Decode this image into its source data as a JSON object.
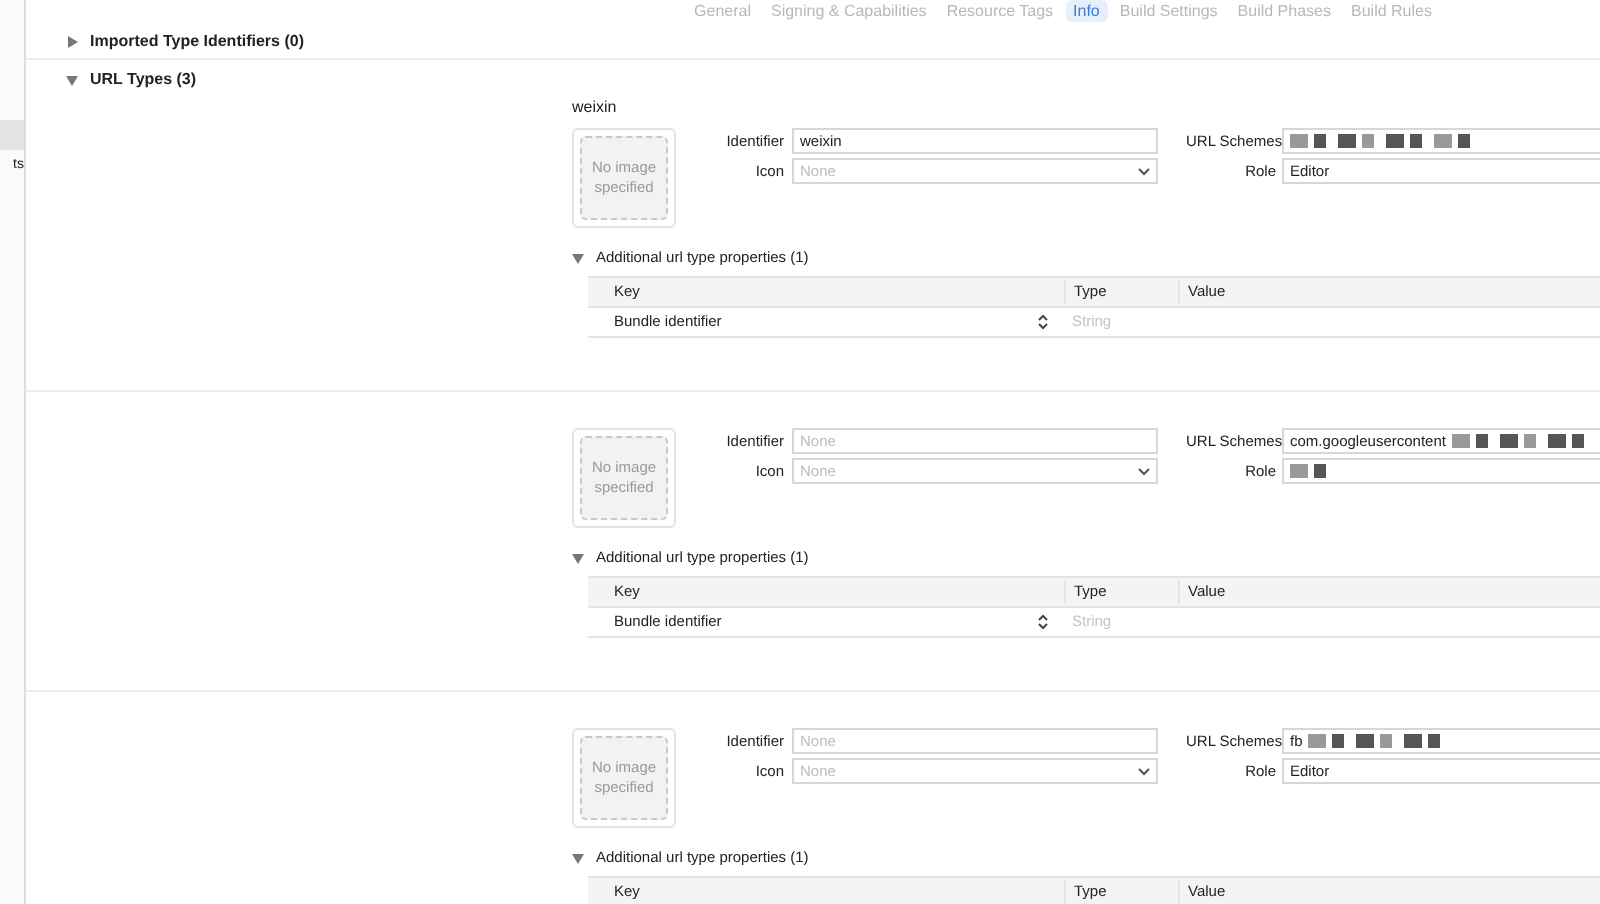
{
  "tabs": [
    {
      "label": "General",
      "selected": false
    },
    {
      "label": "Signing & Capabilities",
      "selected": false
    },
    {
      "label": "Resource Tags",
      "selected": false
    },
    {
      "label": "Info",
      "selected": true
    },
    {
      "label": "Build Settings",
      "selected": false
    },
    {
      "label": "Build Phases",
      "selected": false
    },
    {
      "label": "Build Rules",
      "selected": false
    }
  ],
  "sidebar": {
    "items": [
      {
        "label": "ts",
        "selected": false
      }
    ]
  },
  "sections": [
    {
      "title": "Imported Type Identifiers (0)",
      "expanded": false
    },
    {
      "title": "URL Types (3)",
      "expanded": true
    }
  ],
  "url_types": [
    {
      "name": "weixin",
      "image_text": "No image specified",
      "identifier_label": "Identifier",
      "identifier": "weixin",
      "icon_label": "Icon",
      "icon_placeholder": "None",
      "schemes_label": "URL Schemes",
      "scheme_redacted": true,
      "role_label": "Role",
      "role": "Editor",
      "role_redacted": false,
      "additional": {
        "title": "Additional url type properties (1)",
        "expanded": true,
        "columns": [
          "Key",
          "Type",
          "Value"
        ],
        "rows": [
          {
            "key": "Bundle identifier",
            "type_placeholder": "String"
          }
        ]
      }
    },
    {
      "image_text": "No image specified",
      "identifier_label": "Identifier",
      "identifier_placeholder": "None",
      "icon_label": "Icon",
      "icon_placeholder": "None",
      "schemes_label": "URL Schemes",
      "scheme": "com.googleusercontent",
      "scheme_redacted": true,
      "role_label": "Role",
      "role_redacted": true,
      "additional": {
        "title": "Additional url type properties (1)",
        "expanded": true,
        "columns": [
          "Key",
          "Type",
          "Value"
        ],
        "rows": [
          {
            "key": "Bundle identifier",
            "type_placeholder": "String"
          }
        ]
      }
    },
    {
      "image_text": "No image specified",
      "identifier_label": "Identifier",
      "identifier_placeholder": "None",
      "icon_label": "Icon",
      "icon_placeholder": "None",
      "schemes_label": "URL Schemes",
      "scheme": "fb",
      "scheme_redacted": true,
      "role_label": "Role",
      "role": "Editor",
      "role_redacted": false,
      "additional": {
        "title": "Additional url type properties (1)",
        "expanded": true,
        "columns": [
          "Key",
          "Type",
          "Value"
        ]
      }
    }
  ]
}
